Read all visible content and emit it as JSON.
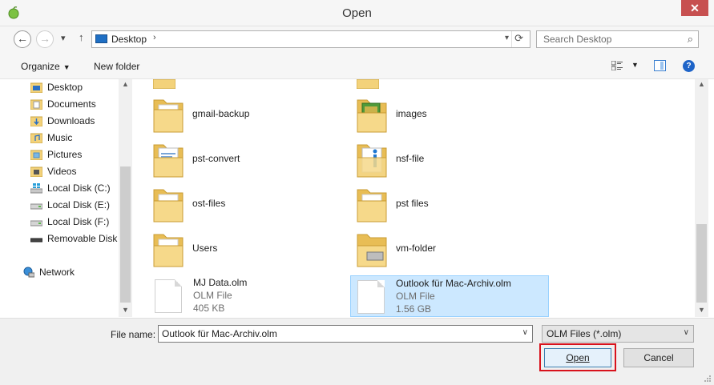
{
  "window": {
    "title": "Open",
    "close_label": "✕"
  },
  "nav": {
    "back_glyph": "←",
    "forward_glyph": "→",
    "recent_glyph": "▾",
    "up_glyph": "↑",
    "address": "Desktop",
    "address_chevron": "›",
    "address_dropdown": "▾",
    "refresh_glyph": "⟳",
    "search_placeholder": "Search Desktop",
    "search_glyph": "⌕"
  },
  "toolbar": {
    "organize_label": "Organize",
    "organize_caret": "▼",
    "new_folder_label": "New folder",
    "view_caret": "▼",
    "help_glyph": "?"
  },
  "sidebar": {
    "items": [
      {
        "label": "Desktop",
        "icon": "desktop-folder-icon"
      },
      {
        "label": "Documents",
        "icon": "documents-folder-icon"
      },
      {
        "label": "Downloads",
        "icon": "downloads-folder-icon"
      },
      {
        "label": "Music",
        "icon": "music-folder-icon"
      },
      {
        "label": "Pictures",
        "icon": "pictures-folder-icon"
      },
      {
        "label": "Videos",
        "icon": "videos-folder-icon"
      },
      {
        "label": "Local Disk (C:)",
        "icon": "windows-drive-icon"
      },
      {
        "label": "Local Disk (E:)",
        "icon": "drive-icon"
      },
      {
        "label": "Local Disk (F:)",
        "icon": "drive-icon"
      },
      {
        "label": "Removable Disk (",
        "icon": "removable-drive-icon"
      }
    ],
    "network_label": "Network",
    "scroll_up": "▲",
    "scroll_down": "▼"
  },
  "main": {
    "folders": [
      {
        "name": "gmail-backup",
        "icon": "folder-icon"
      },
      {
        "name": "images",
        "icon": "image-folder-icon"
      },
      {
        "name": "pst-convert",
        "icon": "doc-folder-icon"
      },
      {
        "name": "nsf-file",
        "icon": "nsf-folder-icon"
      },
      {
        "name": "ost-files",
        "icon": "folder-icon"
      },
      {
        "name": "pst files",
        "icon": "folder-icon"
      },
      {
        "name": "Users",
        "icon": "folder-icon"
      },
      {
        "name": "vm-folder",
        "icon": "vm-folder-icon"
      }
    ],
    "files": [
      {
        "name": "MJ Data.olm",
        "type": "OLM File",
        "size": "405 KB",
        "selected": false
      },
      {
        "name": "Outlook für Mac-Archiv.olm",
        "type": "OLM File",
        "size": "1.56 GB",
        "selected": true
      }
    ],
    "scroll_up": "▲",
    "scroll_down": "▼"
  },
  "footer": {
    "file_name_label": "File name:",
    "file_name_value": "Outlook für Mac-Archiv.olm",
    "file_type_value": "OLM Files (*.olm)",
    "dropdown_glyph": "∨",
    "open_label": "Open",
    "cancel_label": "Cancel"
  },
  "colors": {
    "selection": "#cce8ff",
    "highlight_border": "#d8121c",
    "folder": "#f3d27a"
  }
}
